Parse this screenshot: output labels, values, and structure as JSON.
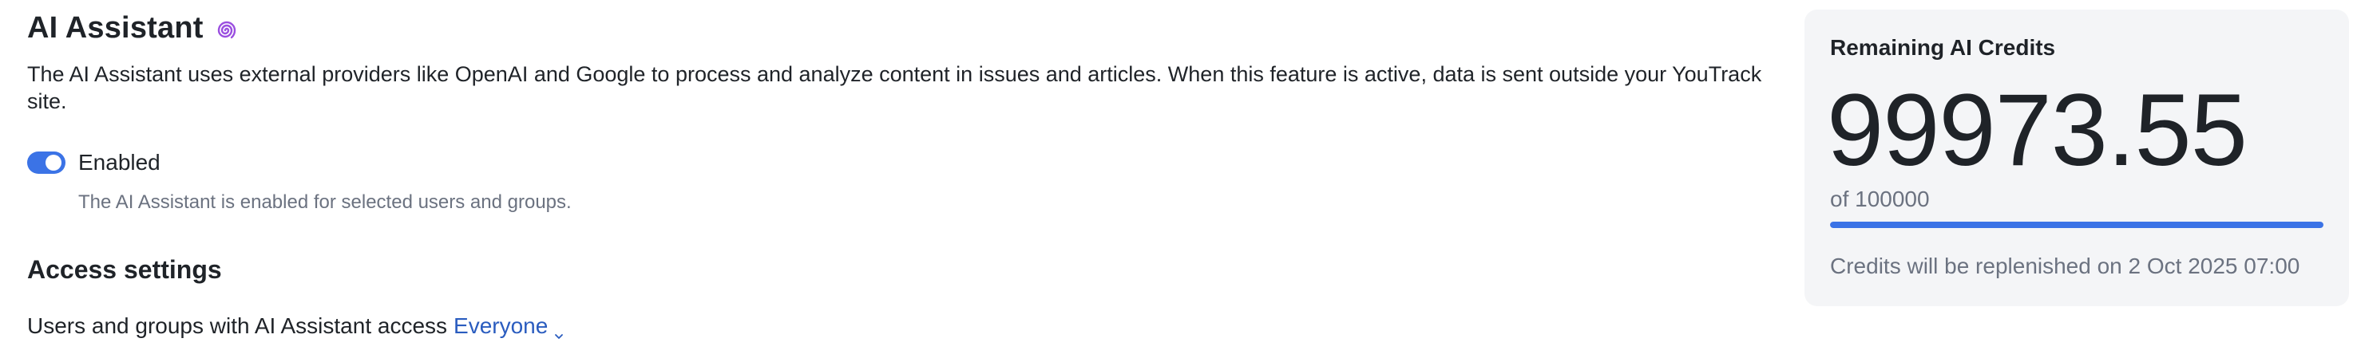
{
  "header": {
    "title": "AI Assistant",
    "icon": "ai-spiral-icon",
    "icon_color": "#9b4fe0"
  },
  "description": "The AI Assistant uses external providers like OpenAI and Google to process and analyze content in issues and articles. When this feature is active, data is sent outside your YouTrack site.",
  "toggle": {
    "label": "Enabled",
    "checked": true,
    "hint": "The AI Assistant is enabled for selected users and groups.",
    "color": "#3b73e6"
  },
  "access": {
    "section_title": "Access settings",
    "label": "Users and groups with AI Assistant access",
    "value": "Everyone",
    "icon": "chevron-down-icon",
    "link_color": "#2a5cbf"
  },
  "credits": {
    "title": "Remaining AI Credits",
    "remaining": "99973.55",
    "total_text": "of 100000",
    "fraction_remaining": 0.9997355,
    "footer": "Credits will be replenished on 2 Oct 2025 07:00"
  }
}
